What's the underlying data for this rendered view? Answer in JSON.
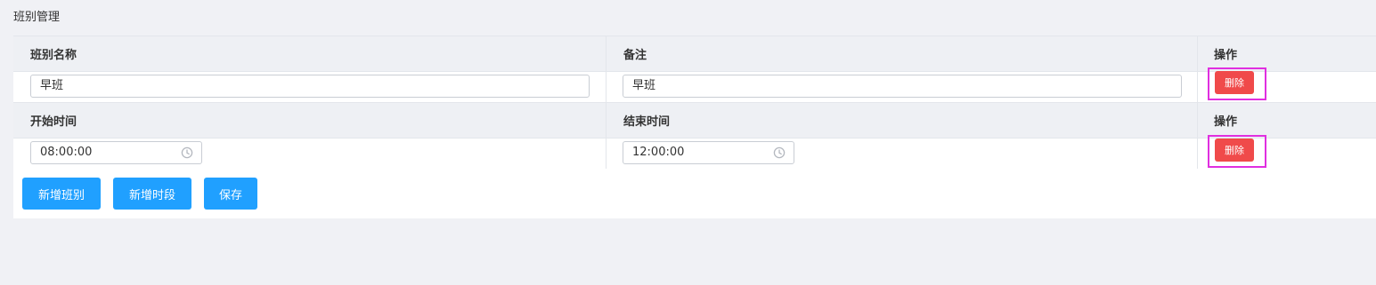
{
  "page": {
    "title": "班别管理"
  },
  "shift_table": {
    "headers": {
      "name": "班别名称",
      "remark": "备注",
      "operation": "操作"
    },
    "row": {
      "name_value": "早班",
      "remark_value": "早班",
      "delete_label": "删除"
    }
  },
  "period_table": {
    "headers": {
      "start": "开始时间",
      "end": "结束时间",
      "operation": "操作"
    },
    "row": {
      "start_value": "08:00:00",
      "end_value": "12:00:00",
      "delete_label": "删除"
    }
  },
  "actions": {
    "add_shift": "新增班别",
    "add_period": "新增时段",
    "save": "保存"
  },
  "colors": {
    "primary": "#20a0ff",
    "danger": "#f04a4a",
    "highlight": "#e02fe0"
  },
  "icons": {
    "time": "clock-icon"
  }
}
